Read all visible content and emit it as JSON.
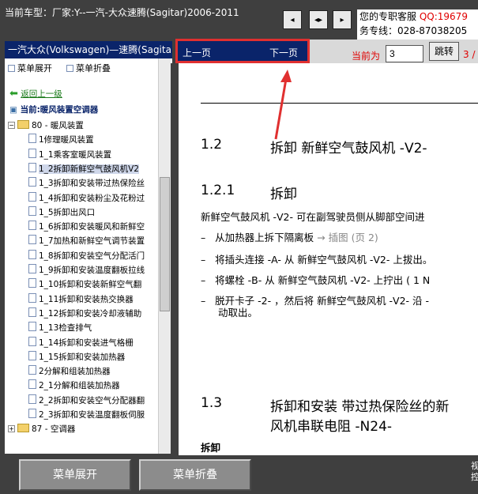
{
  "header": {
    "car_title": "当前车型：厂家:Y--一汽-大众速腾(Sagitar)2006-2011",
    "support_line1": "您的专职客服",
    "support_qq": "QQ:19679",
    "support_line2": "务专线：028-87038205"
  },
  "nav_buttons": [
    {
      "icon": "prev-icon",
      "glyph": "◂"
    },
    {
      "icon": "split-icon",
      "glyph": "◂▸"
    },
    {
      "icon": "next-icon",
      "glyph": "▸"
    }
  ],
  "sidebar": {
    "header": "一汽大众(Volkswagen)—速腾(Sagitar)",
    "expand_label": "菜单展开",
    "collapse_label": "菜单折叠",
    "back_label": "返回上一级",
    "current_label": "当前:暖风装置空调器",
    "tree": [
      {
        "type": "folder",
        "label": "80 - 暖风装置",
        "level": 0
      },
      {
        "type": "doc",
        "label": "1修理暖风装置",
        "level": 1
      },
      {
        "type": "doc",
        "label": "1_1乘客室暖风装置",
        "level": 1
      },
      {
        "type": "doc",
        "label": "1_2拆卸新鲜空气鼓风机V2",
        "level": 1,
        "selected": true
      },
      {
        "type": "doc",
        "label": "1_3拆卸和安装带过热保险丝",
        "level": 1
      },
      {
        "type": "doc",
        "label": "1_4拆卸和安装粉尘及花粉过",
        "level": 1
      },
      {
        "type": "doc",
        "label": "1_5拆卸出风口",
        "level": 1
      },
      {
        "type": "doc",
        "label": "1_6拆卸和安装暖风和新鲜空",
        "level": 1
      },
      {
        "type": "doc",
        "label": "1_7加热和新鲜空气调节装置",
        "level": 1
      },
      {
        "type": "doc",
        "label": "1_8拆卸和安装空气分配活门",
        "level": 1
      },
      {
        "type": "doc",
        "label": "1_9拆卸和安装温度翻板拉线",
        "level": 1
      },
      {
        "type": "doc",
        "label": "1_10拆卸和安装新鲜空气翻",
        "level": 1
      },
      {
        "type": "doc",
        "label": "1_11拆卸和安装热交换器",
        "level": 1
      },
      {
        "type": "doc",
        "label": "1_12拆卸和安装冷却液辅助",
        "level": 1
      },
      {
        "type": "doc",
        "label": "1_13检查排气",
        "level": 1
      },
      {
        "type": "doc",
        "label": "1_14拆卸和安装进气格栅",
        "level": 1
      },
      {
        "type": "doc",
        "label": "1_15拆卸和安装加热器",
        "level": 1
      },
      {
        "type": "doc",
        "label": "2分解和组装加热器",
        "level": 1
      },
      {
        "type": "doc",
        "label": "2_1分解和组装加热器",
        "level": 1
      },
      {
        "type": "doc",
        "label": "2_2拆卸和安装空气分配器翻",
        "level": 1
      },
      {
        "type": "doc",
        "label": "2_3拆卸和安装温度翻板伺服",
        "level": 1
      },
      {
        "type": "folder",
        "label": "87 - 空调器",
        "level": 0,
        "plus": true
      }
    ]
  },
  "pager": {
    "prev_label": "上一页",
    "next_label": "下一页",
    "current_label": "当前为",
    "page_value": "3",
    "jump_label": "跳转",
    "total_text": "3 /"
  },
  "doc": {
    "sec1_num": "1.2",
    "sec1_title": "拆卸 新鲜空气鼓风机 -V2-",
    "sec2_num": "1.2.1",
    "sec2_title": "拆卸",
    "para": "新鲜空气鼓风机 -V2- 可在副驾驶员侧从脚部空间进",
    "bullets": [
      {
        "text": "从加热器上拆下隔离板",
        "link": "→ 插图 (页 2)"
      },
      {
        "text": "将插头连接 -A- 从 新鲜空气鼓风机 -V2- 上拔出。"
      },
      {
        "text": "将螺栓 -B- 从 新鲜空气鼓风机 -V2- 上拧出 ( 1 N"
      },
      {
        "text": "脱开卡子 -2- ，然后将 新鲜空气鼓风机 -V2- 沿 -",
        "cont": "动取出。"
      }
    ],
    "sec3_num": "1.3",
    "sec3_title_l1": "拆卸和安装 带过热保险丝的新",
    "sec3_title_l2": "风机串联电阻 -N24-",
    "sec3_sub": "拆卸"
  },
  "footer": {
    "expand_label": "菜单展开",
    "collapse_label": "菜单折叠",
    "corner_l1": "视",
    "corner_l2": "控"
  },
  "colors": {
    "accent_red": "#e03030",
    "nav_blue": "#0a246a",
    "page_red": "#e00000"
  }
}
